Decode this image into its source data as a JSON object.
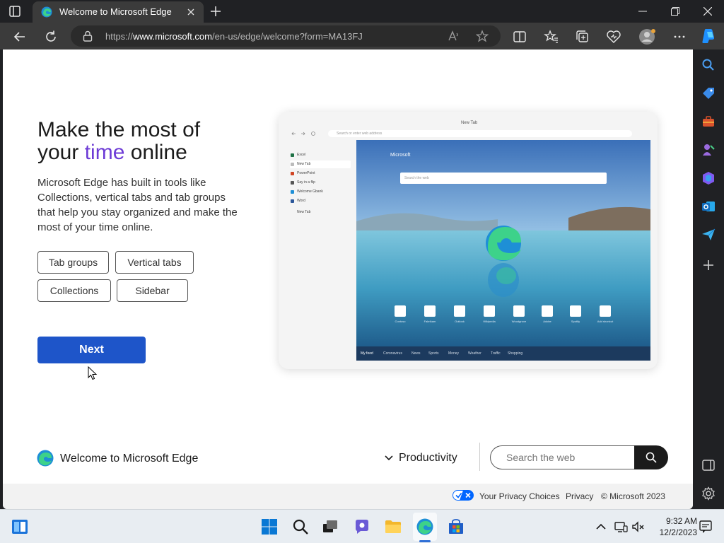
{
  "browser": {
    "tab_title": "Welcome to Microsoft Edge",
    "url_prefix": "https://",
    "url_domain": "www.microsoft.com",
    "url_path": "/en-us/edge/welcome?form=MA13FJ"
  },
  "hero": {
    "headline_1": "Make the most of",
    "headline_2_pre": "your ",
    "headline_2_accent": "time",
    "headline_2_post": " online",
    "description": "Microsoft Edge has built in tools like Collections, vertical tabs and tab groups that help you stay organized and make the most of your time online.",
    "chips": [
      "Tab groups",
      "Vertical tabs",
      "Collections",
      "Sidebar"
    ],
    "next_label": "Next"
  },
  "preview": {
    "tab_title": "New Tab",
    "address_placeholder": "Search or enter web address",
    "vertical_tabs": [
      "Excel",
      "New Tab",
      "PowerPoint",
      "Say in a flip",
      "Welcome Gbank",
      "Word",
      "New Tab"
    ],
    "brand": "Microsoft",
    "search_placeholder": "Search the web",
    "tiles": [
      "Contoso",
      "Fabrikam",
      "Outlook",
      "Wikipedia",
      "Woodgrove",
      "Adobe",
      "Spotify",
      "Add shortcut"
    ],
    "feed": [
      "My feed",
      "Coronavirus",
      "News",
      "Sports",
      "Money",
      "Weather",
      "Traffic",
      "Shopping"
    ]
  },
  "footer": {
    "title": "Welcome to Microsoft Edge",
    "dropdown_label": "Productivity",
    "search_placeholder": "Search the web",
    "privacy_choices": "Your Privacy Choices",
    "privacy": "Privacy",
    "copyright": "© Microsoft 2023"
  },
  "taskbar": {
    "time": "9:32 AM",
    "date": "12/2/2023"
  },
  "colors": {
    "accent_purple": "#6d3bd6",
    "next_blue": "#1e55c9",
    "browser_dark": "#202124",
    "toolbar": "#3b3b3b"
  }
}
